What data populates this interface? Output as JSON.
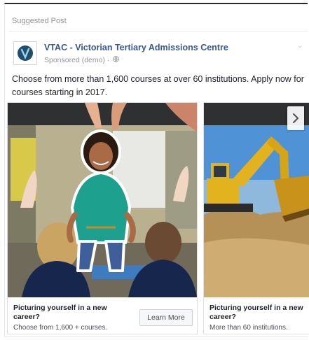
{
  "header": {
    "suggested_label": "Suggested Post"
  },
  "page": {
    "name": "VTAC - Victorian Tertiary Admissions Centre",
    "sponsored_label": "Sponsored (demo) · "
  },
  "post": {
    "text": "Choose from more than 1,600 courses at over 60 institutions. Apply now for courses starting in 2017."
  },
  "carousel": {
    "cards": [
      {
        "title": "Picturing yourself in a new career?",
        "description": "Choose from 1,600 + courses.",
        "cta_label": "Learn More",
        "image_subject": "student-in-classroom"
      },
      {
        "title": "Picturing yourself in a new career?",
        "description": "More than 60 institutions.",
        "image_subject": "excavator-on-construction-site"
      }
    ]
  },
  "colors": {
    "link": "#365899",
    "meta": "#90949c",
    "text": "#1d2129"
  },
  "icons": [
    "vtac-logo-icon",
    "globe-icon",
    "chevron-down-icon",
    "chevron-right-icon"
  ]
}
